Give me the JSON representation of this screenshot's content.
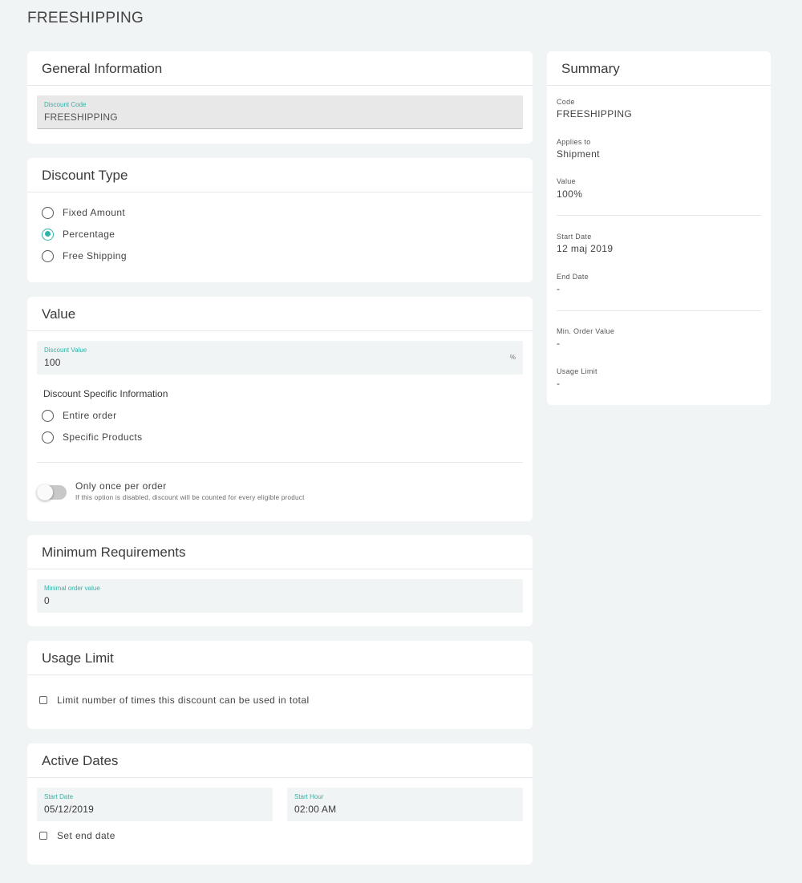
{
  "page": {
    "title": "FREESHIPPING"
  },
  "general": {
    "title": "General Information",
    "code_label": "Discount Code",
    "code_value": "FREESHIPPING"
  },
  "discount_type": {
    "title": "Discount Type",
    "options": [
      {
        "label": "Fixed Amount",
        "checked": false
      },
      {
        "label": "Percentage",
        "checked": true
      },
      {
        "label": "Free Shipping",
        "checked": false
      }
    ]
  },
  "value": {
    "title": "Value",
    "field_label": "Discount Value",
    "field_value": "100",
    "suffix": "%",
    "specific_title": "Discount Specific Information",
    "options": [
      {
        "label": "Entire order",
        "checked": false
      },
      {
        "label": "Specific Products",
        "checked": false
      }
    ],
    "toggle_label": "Only once per order",
    "toggle_hint": "If this option is disabled, discount will be counted for every eligible product",
    "toggle_on": false
  },
  "minimum": {
    "title": "Minimum Requirements",
    "field_label": "Minimal order value",
    "field_value": "0"
  },
  "usage": {
    "title": "Usage Limit",
    "checkbox_label": "Limit number of times this discount can be used in total"
  },
  "dates": {
    "title": "Active Dates",
    "start_date_label": "Start Date",
    "start_date_value": "05/12/2019",
    "start_hour_label": "Start Hour",
    "start_hour_value": "02:00 AM",
    "end_checkbox_label": "Set end date"
  },
  "summary": {
    "title": "Summary",
    "items": [
      {
        "label": "Code",
        "value": "FREESHIPPING"
      },
      {
        "label": "Applies to",
        "value": "Shipment"
      },
      {
        "label": "Value",
        "value": "100%"
      },
      {
        "label": "Start Date",
        "value": "12 maj 2019"
      },
      {
        "label": "End Date",
        "value": "-"
      },
      {
        "label": "Min. Order Value",
        "value": "-"
      },
      {
        "label": "Usage Limit",
        "value": "-"
      }
    ]
  },
  "colors": {
    "accent": "#2fb4a9",
    "background": "#f1f4f4",
    "card": "#ffffff"
  }
}
